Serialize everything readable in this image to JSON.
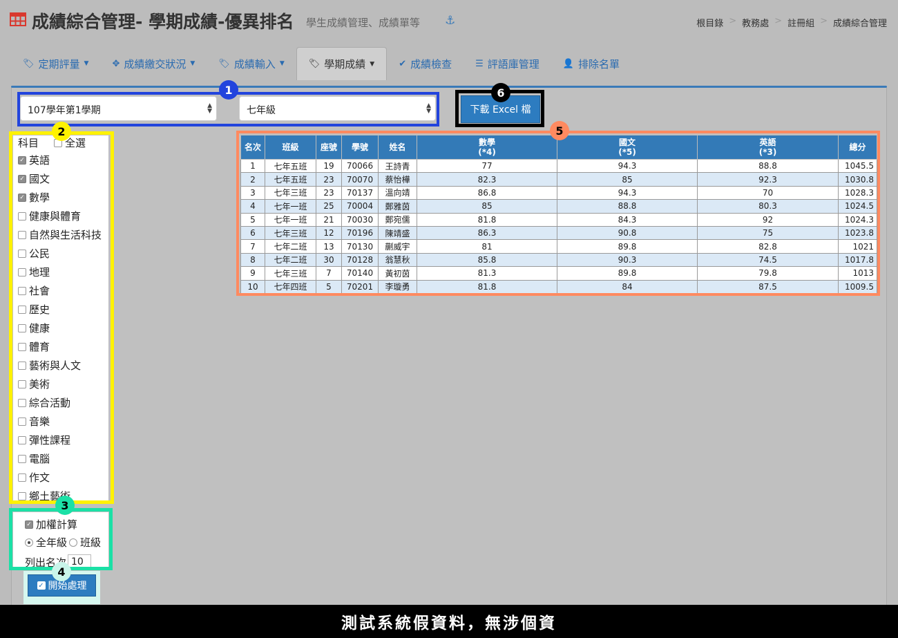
{
  "header": {
    "title": "成績綜合管理- 學期成績-優異排名",
    "subtitle": "學生成績管理、成績單等",
    "breadcrumb": [
      "根目錄",
      "教務處",
      "註冊組",
      "成績綜合管理"
    ]
  },
  "tabs": [
    {
      "label": "定期評量",
      "icon": "tags-icon",
      "dropdown": true
    },
    {
      "label": "成績繳交狀況",
      "icon": "crosshair-icon",
      "dropdown": true
    },
    {
      "label": "成績輸入",
      "icon": "tags-icon",
      "dropdown": true
    },
    {
      "label": "學期成績",
      "icon": "tags-icon",
      "dropdown": true,
      "active": true
    },
    {
      "label": "成績檢查",
      "icon": "check-circle-icon",
      "dropdown": false
    },
    {
      "label": "評語庫管理",
      "icon": "database-icon",
      "dropdown": false
    },
    {
      "label": "排除名單",
      "icon": "user-remove-icon",
      "dropdown": false
    }
  ],
  "filters": {
    "semester": "107學年第1學期",
    "grade": "七年級"
  },
  "export_button": "下載 Excel 檔",
  "subjects": {
    "header": "科目",
    "select_all": "全選",
    "items": [
      {
        "label": "英語",
        "checked": true
      },
      {
        "label": "國文",
        "checked": true
      },
      {
        "label": "數學",
        "checked": true
      },
      {
        "label": "健康與體育",
        "checked": false
      },
      {
        "label": "自然與生活科技",
        "checked": false
      },
      {
        "label": "公民",
        "checked": false
      },
      {
        "label": "地理",
        "checked": false
      },
      {
        "label": "社會",
        "checked": false
      },
      {
        "label": "歷史",
        "checked": false
      },
      {
        "label": "健康",
        "checked": false
      },
      {
        "label": "體育",
        "checked": false
      },
      {
        "label": "藝術與人文",
        "checked": false
      },
      {
        "label": "美術",
        "checked": false
      },
      {
        "label": "綜合活動",
        "checked": false
      },
      {
        "label": "音樂",
        "checked": false
      },
      {
        "label": "彈性課程",
        "checked": false
      },
      {
        "label": "電腦",
        "checked": false
      },
      {
        "label": "作文",
        "checked": false
      },
      {
        "label": "鄉土藝術",
        "checked": false
      }
    ]
  },
  "options": {
    "weighted_label": "加權計算",
    "weighted_checked": true,
    "scope_all": "全年級",
    "scope_class": "班級",
    "list_label": "列出名次",
    "list_count": "10"
  },
  "start_button": "開始處理",
  "table": {
    "headers": [
      "名次",
      "班級",
      "座號",
      "學號",
      "姓名",
      "數學\n(*4)",
      "國文\n(*5)",
      "英語\n(*3)",
      "總分"
    ],
    "rows": [
      [
        "1",
        "七年五班",
        "19",
        "70066",
        "王詩青",
        "77",
        "94.3",
        "88.8",
        "1045.5"
      ],
      [
        "2",
        "七年五班",
        "23",
        "70070",
        "蔡怡樺",
        "82.3",
        "85",
        "92.3",
        "1030.8"
      ],
      [
        "3",
        "七年三班",
        "23",
        "70137",
        "溫向靖",
        "86.8",
        "94.3",
        "70",
        "1028.3"
      ],
      [
        "4",
        "七年一班",
        "25",
        "70004",
        "鄭雅茵",
        "85",
        "88.8",
        "80.3",
        "1024.5"
      ],
      [
        "5",
        "七年一班",
        "21",
        "70030",
        "鄭宛儒",
        "81.8",
        "84.3",
        "92",
        "1024.3"
      ],
      [
        "6",
        "七年三班",
        "12",
        "70196",
        "陳靖盛",
        "86.3",
        "90.8",
        "75",
        "1023.8"
      ],
      [
        "7",
        "七年二班",
        "13",
        "70130",
        "蒯威宇",
        "81",
        "89.8",
        "82.8",
        "1021"
      ],
      [
        "8",
        "七年二班",
        "30",
        "70128",
        "翁慧秋",
        "85.8",
        "90.3",
        "74.5",
        "1017.8"
      ],
      [
        "9",
        "七年三班",
        "7",
        "70140",
        "黃初茵",
        "81.3",
        "89.8",
        "79.8",
        "1013"
      ],
      [
        "10",
        "七年四班",
        "5",
        "70201",
        "李璇勇",
        "81.8",
        "84",
        "87.5",
        "1009.5"
      ]
    ]
  },
  "annotations": [
    {
      "number": "1",
      "color": "#2244dd"
    },
    {
      "number": "2",
      "color": "#fff200"
    },
    {
      "number": "3",
      "color": "#1be0a6"
    },
    {
      "number": "4",
      "color": "#c9f5ea"
    },
    {
      "number": "5",
      "color": "#ff8a60"
    },
    {
      "number": "6",
      "color": "#000000"
    }
  ],
  "footer_note": "測試系統假資料，無涉個資"
}
